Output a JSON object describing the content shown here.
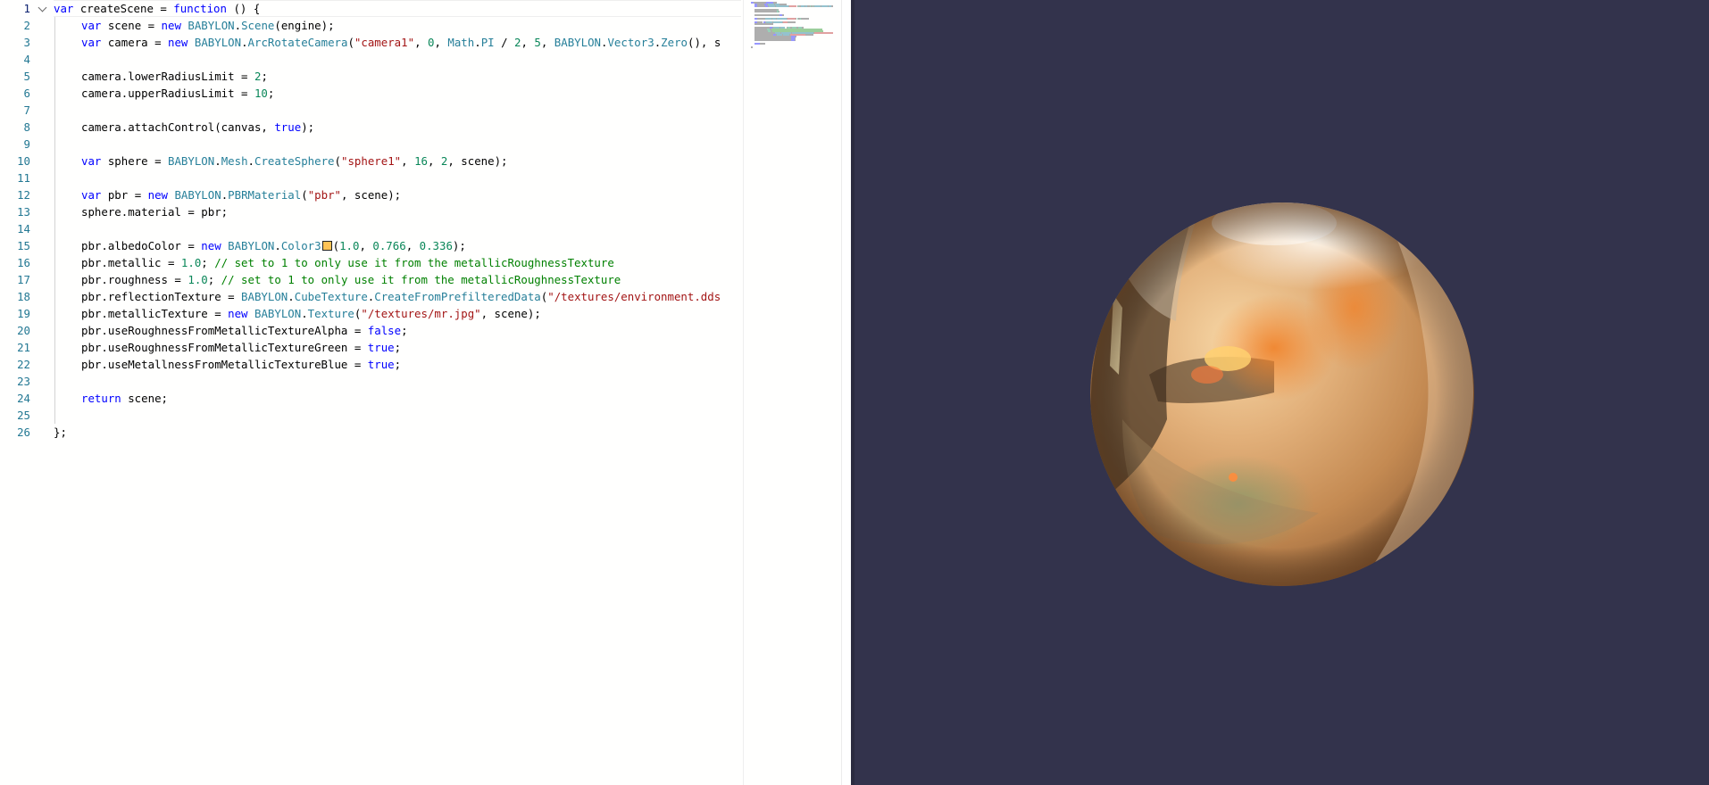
{
  "editor": {
    "active_line": 1,
    "lines": [
      {
        "n": 1,
        "indent": 0,
        "tokens": [
          {
            "t": "var",
            "c": "kw"
          },
          {
            "t": " createScene = "
          },
          {
            "t": "function",
            "c": "kw"
          },
          {
            "t": " () {"
          }
        ]
      },
      {
        "n": 2,
        "indent": 1,
        "tokens": [
          {
            "t": "var",
            "c": "kw"
          },
          {
            "t": " scene = "
          },
          {
            "t": "new",
            "c": "kw"
          },
          {
            "t": " "
          },
          {
            "t": "BABYLON",
            "c": "cls"
          },
          {
            "t": "."
          },
          {
            "t": "Scene",
            "c": "cls"
          },
          {
            "t": "(engine);"
          }
        ]
      },
      {
        "n": 3,
        "indent": 1,
        "tokens": [
          {
            "t": "var",
            "c": "kw"
          },
          {
            "t": " camera = "
          },
          {
            "t": "new",
            "c": "kw"
          },
          {
            "t": " "
          },
          {
            "t": "BABYLON",
            "c": "cls"
          },
          {
            "t": "."
          },
          {
            "t": "ArcRotateCamera",
            "c": "cls"
          },
          {
            "t": "("
          },
          {
            "t": "\"camera1\"",
            "c": "str"
          },
          {
            "t": ", "
          },
          {
            "t": "0",
            "c": "num"
          },
          {
            "t": ", "
          },
          {
            "t": "Math",
            "c": "cls"
          },
          {
            "t": "."
          },
          {
            "t": "PI",
            "c": "cls"
          },
          {
            "t": " / "
          },
          {
            "t": "2",
            "c": "num"
          },
          {
            "t": ", "
          },
          {
            "t": "5",
            "c": "num"
          },
          {
            "t": ", "
          },
          {
            "t": "BABYLON",
            "c": "cls"
          },
          {
            "t": "."
          },
          {
            "t": "Vector3",
            "c": "cls"
          },
          {
            "t": "."
          },
          {
            "t": "Zero",
            "c": "cls"
          },
          {
            "t": "(), s"
          }
        ]
      },
      {
        "n": 4,
        "indent": 0,
        "tokens": []
      },
      {
        "n": 5,
        "indent": 1,
        "tokens": [
          {
            "t": "camera.lowerRadiusLimit = "
          },
          {
            "t": "2",
            "c": "num"
          },
          {
            "t": ";"
          }
        ]
      },
      {
        "n": 6,
        "indent": 1,
        "tokens": [
          {
            "t": "camera.upperRadiusLimit = "
          },
          {
            "t": "10",
            "c": "num"
          },
          {
            "t": ";"
          }
        ]
      },
      {
        "n": 7,
        "indent": 0,
        "tokens": []
      },
      {
        "n": 8,
        "indent": 1,
        "tokens": [
          {
            "t": "camera.attachControl(canvas, "
          },
          {
            "t": "true",
            "c": "kw"
          },
          {
            "t": ");"
          }
        ]
      },
      {
        "n": 9,
        "indent": 0,
        "tokens": []
      },
      {
        "n": 10,
        "indent": 1,
        "tokens": [
          {
            "t": "var",
            "c": "kw"
          },
          {
            "t": " sphere = "
          },
          {
            "t": "BABYLON",
            "c": "cls"
          },
          {
            "t": "."
          },
          {
            "t": "Mesh",
            "c": "cls"
          },
          {
            "t": "."
          },
          {
            "t": "CreateSphere",
            "c": "cls"
          },
          {
            "t": "("
          },
          {
            "t": "\"sphere1\"",
            "c": "str"
          },
          {
            "t": ", "
          },
          {
            "t": "16",
            "c": "num"
          },
          {
            "t": ", "
          },
          {
            "t": "2",
            "c": "num"
          },
          {
            "t": ", scene);"
          }
        ]
      },
      {
        "n": 11,
        "indent": 0,
        "tokens": []
      },
      {
        "n": 12,
        "indent": 1,
        "tokens": [
          {
            "t": "var",
            "c": "kw"
          },
          {
            "t": " pbr = "
          },
          {
            "t": "new",
            "c": "kw"
          },
          {
            "t": " "
          },
          {
            "t": "BABYLON",
            "c": "cls"
          },
          {
            "t": "."
          },
          {
            "t": "PBRMaterial",
            "c": "cls"
          },
          {
            "t": "("
          },
          {
            "t": "\"pbr\"",
            "c": "str"
          },
          {
            "t": ", scene);"
          }
        ]
      },
      {
        "n": 13,
        "indent": 1,
        "tokens": [
          {
            "t": "sphere.material = pbr;"
          }
        ]
      },
      {
        "n": 14,
        "indent": 0,
        "tokens": []
      },
      {
        "n": 15,
        "indent": 1,
        "tokens": [
          {
            "t": "pbr.albedoColor = "
          },
          {
            "t": "new",
            "c": "kw"
          },
          {
            "t": " "
          },
          {
            "t": "BABYLON",
            "c": "cls"
          },
          {
            "t": "."
          },
          {
            "t": "Color3",
            "c": "cls"
          },
          {
            "t": "",
            "swatch": "#ffc356"
          },
          {
            "t": "("
          },
          {
            "t": "1.0",
            "c": "num"
          },
          {
            "t": ", "
          },
          {
            "t": "0.766",
            "c": "num"
          },
          {
            "t": ", "
          },
          {
            "t": "0.336",
            "c": "num"
          },
          {
            "t": ");"
          }
        ]
      },
      {
        "n": 16,
        "indent": 1,
        "tokens": [
          {
            "t": "pbr.metallic = "
          },
          {
            "t": "1.0",
            "c": "num"
          },
          {
            "t": "; "
          },
          {
            "t": "// set to 1 to only use it from the metallicRoughnessTexture",
            "c": "cmt"
          }
        ]
      },
      {
        "n": 17,
        "indent": 1,
        "tokens": [
          {
            "t": "pbr.roughness = "
          },
          {
            "t": "1.0",
            "c": "num"
          },
          {
            "t": "; "
          },
          {
            "t": "// set to 1 to only use it from the metallicRoughnessTexture",
            "c": "cmt"
          }
        ]
      },
      {
        "n": 18,
        "indent": 1,
        "tokens": [
          {
            "t": "pbr.reflectionTexture = "
          },
          {
            "t": "BABYLON",
            "c": "cls"
          },
          {
            "t": "."
          },
          {
            "t": "CubeTexture",
            "c": "cls"
          },
          {
            "t": "."
          },
          {
            "t": "CreateFromPrefilteredData",
            "c": "cls"
          },
          {
            "t": "("
          },
          {
            "t": "\"/textures/environment.dds",
            "c": "str"
          }
        ]
      },
      {
        "n": 19,
        "indent": 1,
        "tokens": [
          {
            "t": "pbr.metallicTexture = "
          },
          {
            "t": "new",
            "c": "kw"
          },
          {
            "t": " "
          },
          {
            "t": "BABYLON",
            "c": "cls"
          },
          {
            "t": "."
          },
          {
            "t": "Texture",
            "c": "cls"
          },
          {
            "t": "("
          },
          {
            "t": "\"/textures/mr.jpg\"",
            "c": "str"
          },
          {
            "t": ", scene);"
          }
        ]
      },
      {
        "n": 20,
        "indent": 1,
        "tokens": [
          {
            "t": "pbr.useRoughnessFromMetallicTextureAlpha = "
          },
          {
            "t": "false",
            "c": "kw"
          },
          {
            "t": ";"
          }
        ]
      },
      {
        "n": 21,
        "indent": 1,
        "tokens": [
          {
            "t": "pbr.useRoughnessFromMetallicTextureGreen = "
          },
          {
            "t": "true",
            "c": "kw"
          },
          {
            "t": ";"
          }
        ]
      },
      {
        "n": 22,
        "indent": 1,
        "tokens": [
          {
            "t": "pbr.useMetallnessFromMetallicTextureBlue = "
          },
          {
            "t": "true",
            "c": "kw"
          },
          {
            "t": ";"
          }
        ]
      },
      {
        "n": 23,
        "indent": 0,
        "tokens": []
      },
      {
        "n": 24,
        "indent": 1,
        "tokens": [
          {
            "t": "return",
            "c": "kw"
          },
          {
            "t": " scene;"
          }
        ]
      },
      {
        "n": 25,
        "indent": 0,
        "tokens": []
      },
      {
        "n": 26,
        "indent": 0,
        "tokens": [
          {
            "t": "};"
          }
        ]
      }
    ]
  },
  "colors": {
    "keyword": "#0000ff",
    "class": "#267f99",
    "string": "#a31515",
    "number": "#098658",
    "comment": "#008000",
    "line_number": "#237893",
    "canvas_background": "#33334c",
    "sphere_gold": "#d9a46b"
  },
  "icons": {
    "fold": "chevron-down-icon",
    "color_swatch": "color-swatch-icon"
  }
}
